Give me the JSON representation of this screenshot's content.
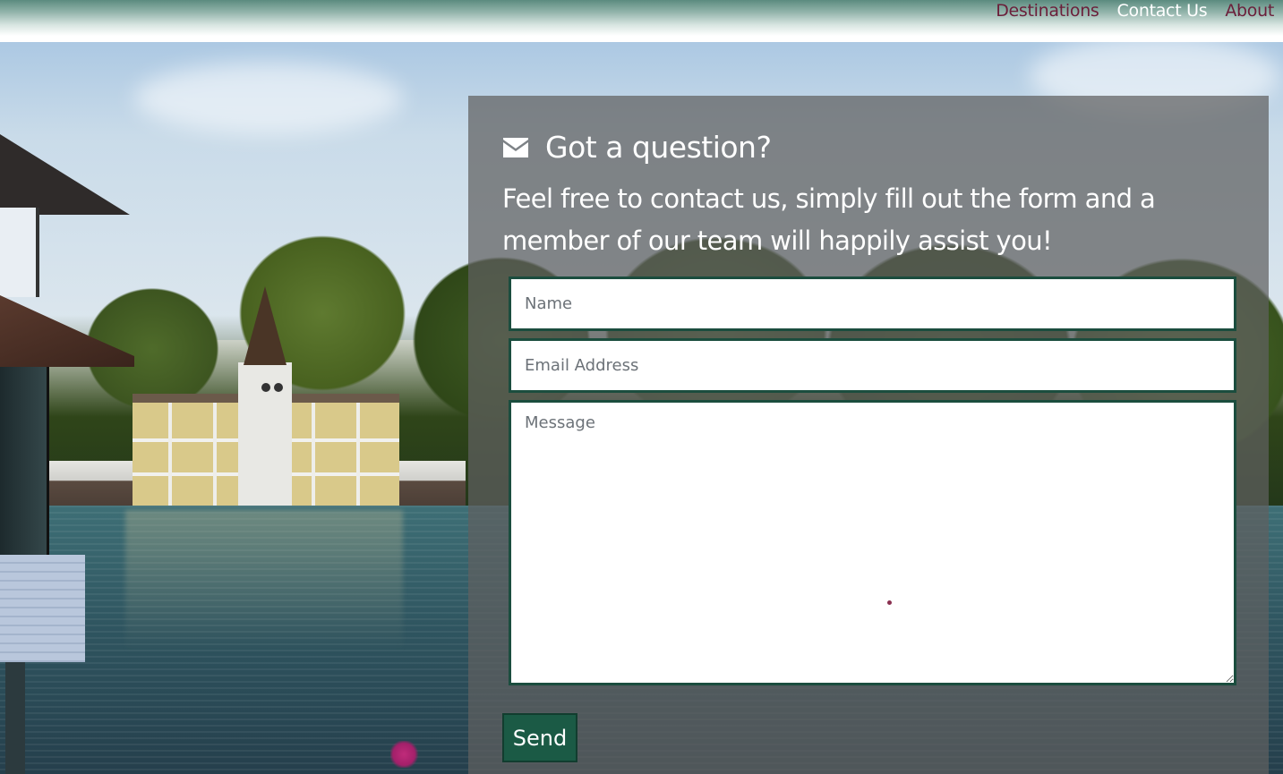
{
  "nav": {
    "items": [
      {
        "label": "Destinations",
        "active": false
      },
      {
        "label": "Contact Us",
        "active": true
      },
      {
        "label": "About",
        "active": false
      }
    ],
    "link_color": "#6b1f3a",
    "active_color": "#ffffff"
  },
  "contact": {
    "icon": "envelope-icon",
    "heading": "Got a question?",
    "intro": "Feel free to contact us, simply fill out the form and a member of our team will happily assist you!",
    "name_placeholder": "Name",
    "name_value": "",
    "email_placeholder": "Email Address",
    "email_value": "",
    "message_placeholder": "Message",
    "message_value": "",
    "send_label": "Send",
    "accent_color": "#1b5a45"
  }
}
